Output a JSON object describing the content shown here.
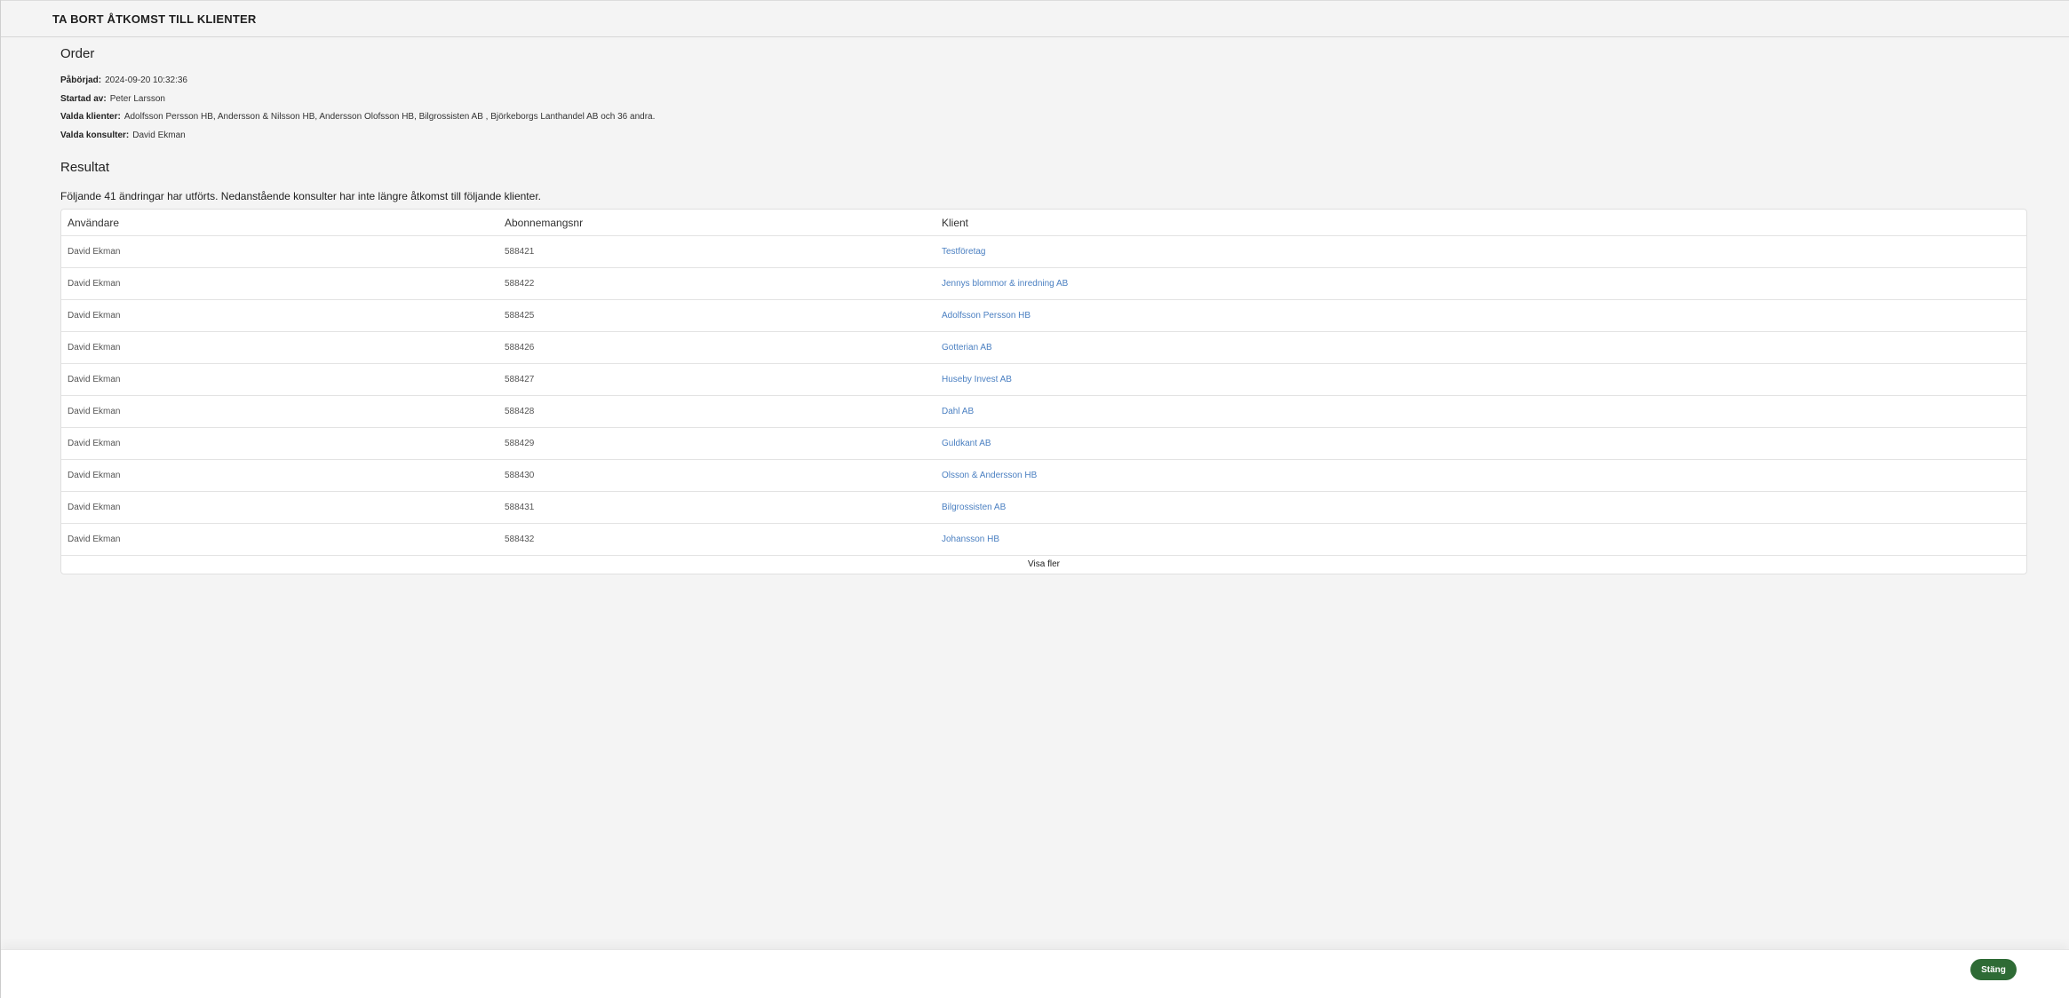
{
  "header": {
    "title": "TA BORT ÅTKOMST TILL KLIENTER"
  },
  "order": {
    "title": "Order",
    "started_label": "Påbörjad:",
    "started_value": "2024-09-20 10:32:36",
    "started_by_label": "Startad av:",
    "started_by_value": "Peter Larsson",
    "clients_label": "Valda klienter:",
    "clients_value": "Adolfsson Persson HB, Andersson & Nilsson HB, Andersson Olofsson HB, Bilgrossisten AB , Björkeborgs Lanthandel AB och 36 andra.",
    "consultants_label": "Valda konsulter:",
    "consultants_value": "David Ekman"
  },
  "result": {
    "title": "Resultat",
    "summary": "Följande 41 ändringar har utförts. Nedanstående konsulter har inte längre åtkomst till följande klienter.",
    "columns": [
      "Användare",
      "Abonnemangsnr",
      "Klient"
    ],
    "rows": [
      {
        "user": "David Ekman",
        "sub": "588421",
        "client": "Testföretag"
      },
      {
        "user": "David Ekman",
        "sub": "588422",
        "client": "Jennys blommor & inredning AB"
      },
      {
        "user": "David Ekman",
        "sub": "588425",
        "client": "Adolfsson Persson HB"
      },
      {
        "user": "David Ekman",
        "sub": "588426",
        "client": "Gotterian AB"
      },
      {
        "user": "David Ekman",
        "sub": "588427",
        "client": "Huseby Invest AB"
      },
      {
        "user": "David Ekman",
        "sub": "588428",
        "client": "Dahl AB"
      },
      {
        "user": "David Ekman",
        "sub": "588429",
        "client": "Guldkant AB"
      },
      {
        "user": "David Ekman",
        "sub": "588430",
        "client": "Olsson & Andersson HB"
      },
      {
        "user": "David Ekman",
        "sub": "588431",
        "client": "Bilgrossisten AB"
      },
      {
        "user": "David Ekman",
        "sub": "588432",
        "client": "Johansson HB"
      }
    ],
    "show_more_label": "Visa fler"
  },
  "footer": {
    "close_label": "Stäng"
  },
  "colors": {
    "link": "#4a7fc1",
    "primary_button": "#2e6b35",
    "background": "#f4f4f4"
  }
}
